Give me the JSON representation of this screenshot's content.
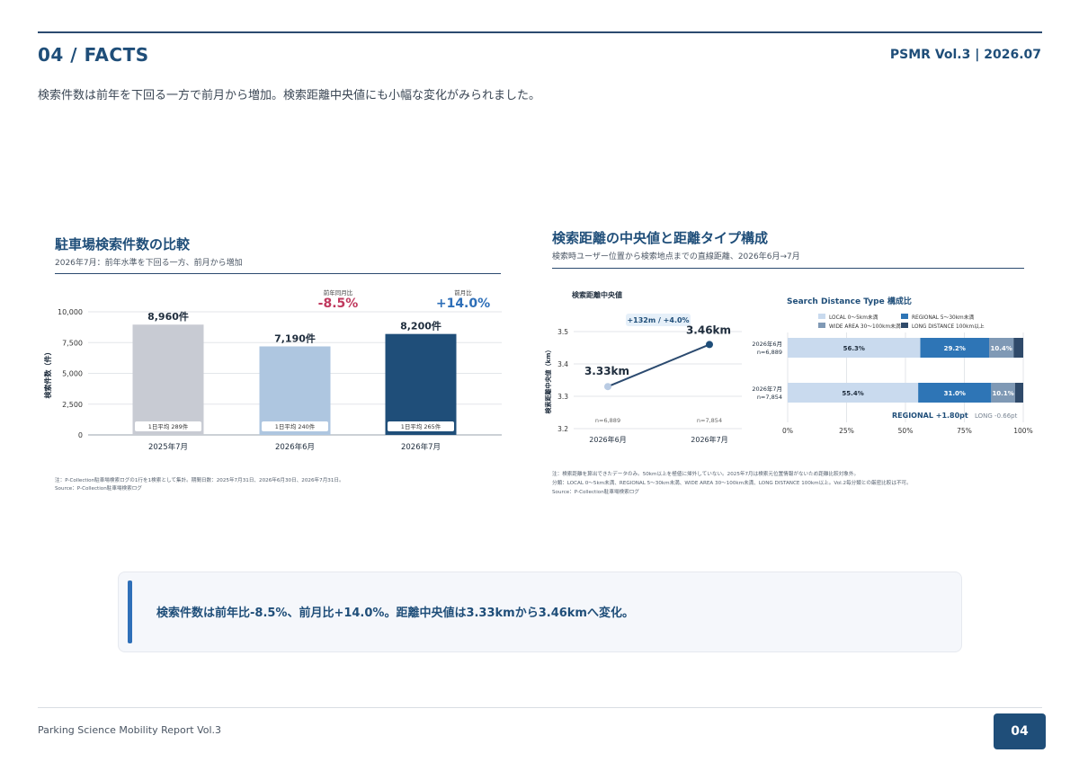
{
  "header": {
    "section": "04 / FACTS",
    "issue": "PSMR Vol.3 | 2026.07",
    "lead": "検索件数は前年を下回る一方で前月から増加。検索距離中央値にも小幅な変化がみられました。"
  },
  "left_panel": {
    "title": "駐車場検索件数の比較",
    "subtitle": "2026年7月：前年水準を下回る一方、前月から増加",
    "note": "注：P-Collection駐車場検索ログの1行を1検索として集計。期間日数：2025年7月31日、2026年6月30日、2026年7月31日。",
    "source": "Source：P-Collection駐車場検索ログ"
  },
  "right_panel": {
    "title": "検索距離の中央値と距離タイプ構成",
    "subtitle": "検索時ユーザー位置から検索地点までの直線距離、2026年6月→7月",
    "note1": "注：検索距離を算出できたデータのみ。50km以上を極値に帰外していない。2025年7月は検索元位置情報がないため距離比較対象外。",
    "note2": "分類：LOCAL 0〜5km未満、REGIONAL 5〜30km未満、WIDE AREA 30〜100km未満、LONG DISTANCE 100km以上。Vol.2毎分類との厳密比較は不可。",
    "source": "Source：P-Collection駐車場検索ログ"
  },
  "callout": "検索件数は前年比-8.5%、前月比+14.0%。距離中央値は3.33kmから3.46kmへ変化。",
  "footer": {
    "report": "Parking Science Mobility Report Vol.3",
    "page": "04"
  },
  "colors": {
    "accent": "#1f4e79",
    "negative": "#c0395e",
    "positive": "#2e6fb8"
  },
  "chart_data": [
    {
      "type": "bar",
      "ylabel": "検索件数（件）",
      "ylim": [
        0,
        10000
      ],
      "yticks": [
        "0",
        "2,500",
        "5,000",
        "7,500",
        "10,000"
      ],
      "categories": [
        "2025年7月",
        "2026年6月",
        "2026年7月"
      ],
      "values": [
        8960,
        7190,
        8200
      ],
      "value_labels": [
        "8,960件",
        "7,190件",
        "8,200件"
      ],
      "daily_avg_labels": [
        "1日平均 289件",
        "1日平均 240件",
        "1日平均 265件"
      ],
      "bar_colors": [
        "#c8cbd3",
        "#aec6e0",
        "#1f4e79"
      ],
      "annotations": [
        {
          "label": "前年同月比",
          "value": "-8.5%"
        },
        {
          "label": "前月比",
          "value": "+14.0%"
        }
      ]
    },
    {
      "type": "line",
      "title": "検索距離中央値",
      "ylabel": "検索距離中央値（km）",
      "ylim": [
        3.2,
        3.5
      ],
      "yticks": [
        "3.2",
        "3.3",
        "3.4",
        "3.5"
      ],
      "categories": [
        "2026年6月",
        "2026年7月"
      ],
      "values": [
        3.33,
        3.46
      ],
      "value_labels": [
        "3.33km",
        "3.46km"
      ],
      "n_labels": [
        "n=6,889",
        "n=7,854"
      ],
      "change_label": "+132m / +4.0%"
    },
    {
      "type": "bar",
      "stacked": true,
      "orientation": "horizontal",
      "title": "Search Distance Type 構成比",
      "categories": [
        "2026年6月",
        "2026年7月"
      ],
      "category_n": [
        "n=6,889",
        "n=7,854"
      ],
      "xticks": [
        "0%",
        "25%",
        "50%",
        "75%",
        "100%"
      ],
      "series": [
        {
          "name": "LOCAL 0〜5km未満",
          "values": [
            56.3,
            55.4
          ],
          "color": "#c9daee"
        },
        {
          "name": "REGIONAL 5〜30km未満",
          "values": [
            29.2,
            31.0
          ],
          "color": "#2e75b6"
        },
        {
          "name": "WIDE AREA 30〜100km未満",
          "values": [
            10.4,
            10.1
          ],
          "color": "#7f99b5"
        },
        {
          "name": "LONG DISTANCE 100km以上",
          "values": [
            4.1,
            3.5
          ],
          "color": "#2f4a6a"
        }
      ],
      "segment_labels": [
        [
          "56.3%",
          "29.2%",
          "10.4%"
        ],
        [
          "55.4%",
          "31.0%",
          "10.1%"
        ]
      ],
      "annotations": [
        "REGIONAL +1.80pt",
        "LONG -0.66pt"
      ]
    }
  ]
}
